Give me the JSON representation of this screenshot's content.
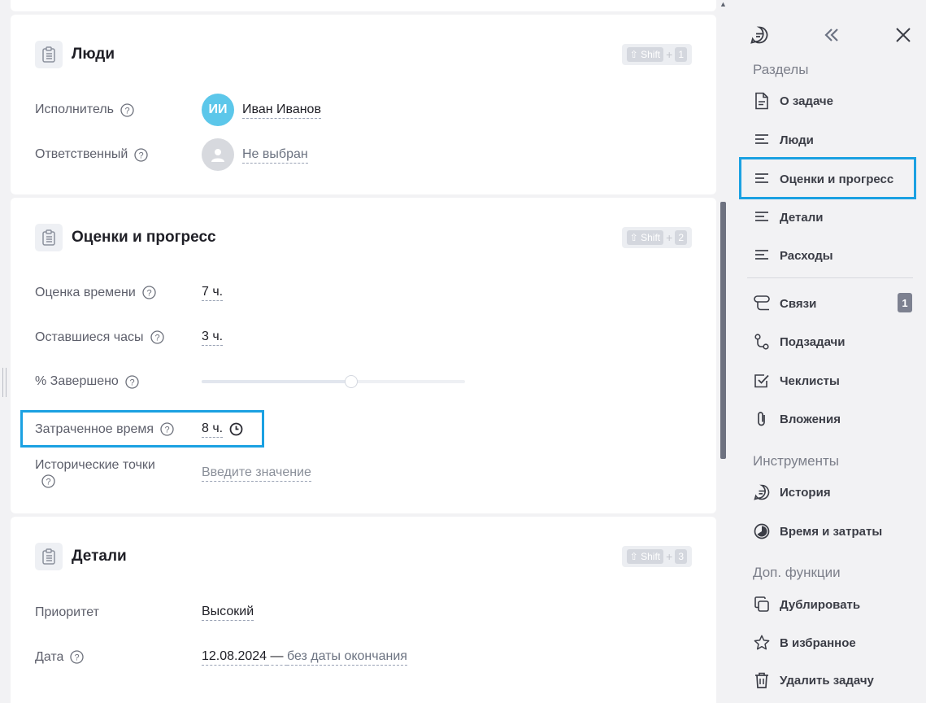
{
  "people": {
    "title": "Люди",
    "shortcut": {
      "key": "Shift",
      "plus": "+",
      "num": "1"
    },
    "assignee": {
      "label": "Исполнитель",
      "initials": "ИИ",
      "name": "Иван Иванов"
    },
    "responsible": {
      "label": "Ответственный",
      "value": "Не выбран"
    }
  },
  "progress": {
    "title": "Оценки и прогресс",
    "shortcut": {
      "key": "Shift",
      "plus": "+",
      "num": "2"
    },
    "estimate": {
      "label": "Оценка времени",
      "value": "7 ч."
    },
    "remaining": {
      "label": "Оставшиеся часы",
      "value": "3 ч."
    },
    "percent": {
      "label": "% Завершено",
      "value": 57
    },
    "spent": {
      "label": "Затраченное время",
      "value": "8 ч."
    },
    "historical": {
      "label": "Исторические точки",
      "placeholder": "Введите значение"
    }
  },
  "details": {
    "title": "Детали",
    "shortcut": {
      "key": "Shift",
      "plus": "+",
      "num": "3"
    },
    "priority": {
      "label": "Приоритет",
      "value": "Высокий"
    },
    "date": {
      "label": "Дата",
      "start": "12.08.2024",
      "dash": " — ",
      "end": "без даты окончания"
    }
  },
  "sidebar": {
    "sections_heading": "Разделы",
    "sections": [
      {
        "label": "О задаче",
        "icon": "document-icon"
      },
      {
        "label": "Люди",
        "icon": "lines-icon"
      },
      {
        "label": "Оценки и прогресс",
        "icon": "lines-icon"
      },
      {
        "label": "Детали",
        "icon": "lines-icon"
      },
      {
        "label": "Расходы",
        "icon": "lines-icon"
      }
    ],
    "links": [
      {
        "label": "Связи",
        "icon": "links-icon",
        "badge": "1"
      },
      {
        "label": "Подзадачи",
        "icon": "subtasks-icon"
      },
      {
        "label": "Чеклисты",
        "icon": "checkbox-icon"
      },
      {
        "label": "Вложения",
        "icon": "paperclip-icon"
      }
    ],
    "tools_heading": "Инструменты",
    "tools": [
      {
        "label": "История",
        "icon": "chat-icon"
      },
      {
        "label": "Время и затраты",
        "icon": "pie-icon"
      }
    ],
    "extra_heading": "Доп. функции",
    "extra": [
      {
        "label": "Дублировать",
        "icon": "copy-icon"
      },
      {
        "label": "В избранное",
        "icon": "star-icon"
      },
      {
        "label": "Удалить задачу",
        "icon": "trash-icon"
      }
    ]
  },
  "colors": {
    "highlight": "#1ba1e2",
    "avatar": "#5cc7ea"
  }
}
